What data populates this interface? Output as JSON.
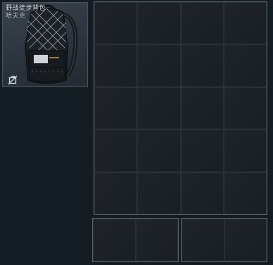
{
  "item": {
    "name": "野战徒步背包",
    "subtitle": "哈夫克",
    "icon": "backpack-image",
    "status_icon": "no-rotate-icon"
  },
  "storage": {
    "main_grid": {
      "columns": 4,
      "rows": 5
    },
    "sub_grids": [
      {
        "columns": 2,
        "rows": 1
      },
      {
        "columns": 2,
        "rows": 1
      }
    ]
  },
  "colors": {
    "background": "#141c24",
    "grid_border": "#5b646b",
    "cell_border": "#2b3137"
  }
}
